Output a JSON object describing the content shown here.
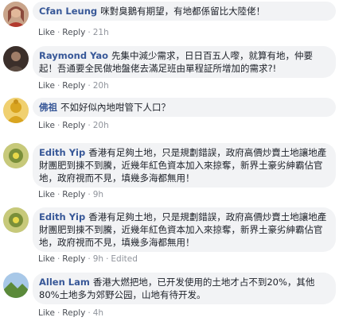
{
  "comments": [
    {
      "author": "Cfan Leung",
      "text": "咪對臭鵝有期望，有地都係留比大陸佬！",
      "like": "Like",
      "reply": "Reply",
      "time": "21h",
      "edited": "",
      "avatar_icon": "profile-photo-woman",
      "avatar_color": "#8b4a3c"
    },
    {
      "author": "Raymond Yao",
      "text": "先集中減少需求，日日百五人嚟，就算有地，仲要起！吾通要全民做地盤佬去滿足班由單程証所增加的需求?!",
      "like": "Like",
      "reply": "Reply",
      "time": "20h",
      "edited": "",
      "avatar_icon": "profile-photo-dark",
      "avatar_color": "#3b2f2a"
    },
    {
      "author": "佛祖",
      "text": "不如好似內地咁管下人口？",
      "like": "Like",
      "reply": "Reply",
      "time": "20h",
      "edited": "",
      "avatar_icon": "profile-photo-buddha",
      "avatar_color": "#d9a520"
    },
    {
      "author": "Edith Yip",
      "text": "香港有足夠土地，只是規劃錯誤，政府高價炒賣土地讓地產財團肥到㨂不到騰，近幾年紅色資本加入來掠奪，新界土豪劣紳霸佔官地，政府視而不見，填幾多海都無用！",
      "like": "Like",
      "reply": "Reply",
      "time": "9h",
      "edited": "",
      "avatar_icon": "profile-photo-flower",
      "avatar_color": "#7a8f3a"
    },
    {
      "author": "Edith Yip",
      "text": "香港有足夠土地，只是規劃錯誤，政府高價炒賣土地讓地產財團肥到㨂不到騰，近幾年紅色資本加入來掠奪，新界土豪劣紳霸佔官地，政府視而不見，填幾多海都無用！",
      "like": "Like",
      "reply": "Reply",
      "time": "9h",
      "edited": "Edited",
      "avatar_icon": "profile-photo-flower",
      "avatar_color": "#7a8f3a"
    },
    {
      "author": "Allen Lam",
      "text": "香港大燃把地，已开发使用的土地才占不到20%，其他80%土地多为郊野公园，山地有待开发。",
      "like": "Like",
      "reply": "Reply",
      "time": "4h",
      "edited": "",
      "avatar_icon": "profile-photo-landscape",
      "avatar_color": "#5b8a3a"
    }
  ]
}
